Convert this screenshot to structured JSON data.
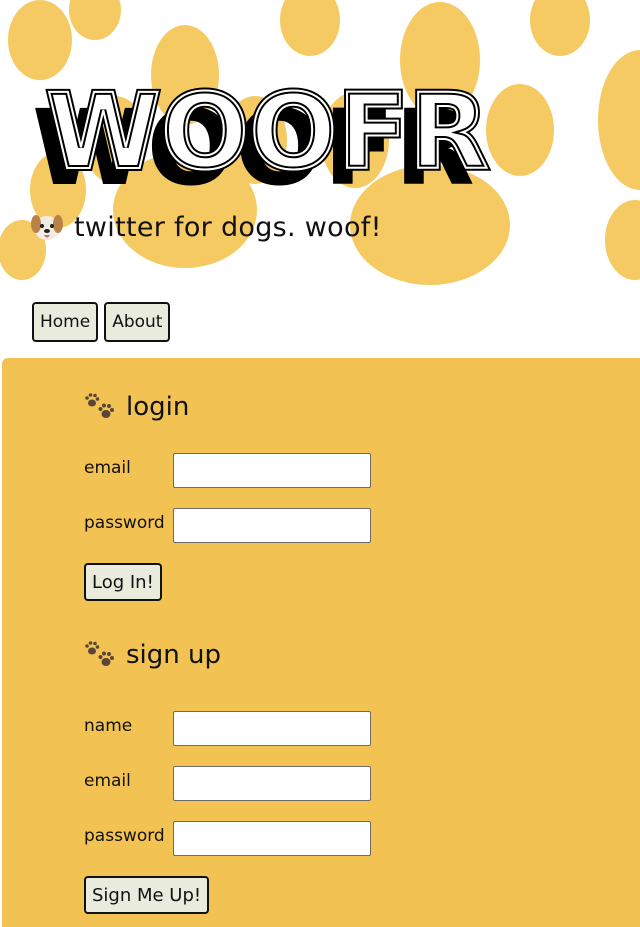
{
  "header": {
    "logo_text": "WOOFR",
    "tagline": "twitter for dogs. woof!",
    "tagline_icon": "dog-face-icon"
  },
  "nav": {
    "items": [
      {
        "label": "Home"
      },
      {
        "label": "About"
      }
    ]
  },
  "login": {
    "title": "login",
    "icon": "paw-prints-icon",
    "email_label": "email",
    "email_value": "",
    "password_label": "password",
    "password_value": "",
    "submit_label": "Log In!"
  },
  "signup": {
    "title": "sign up",
    "icon": "paw-prints-icon",
    "name_label": "name",
    "name_value": "",
    "email_label": "email",
    "email_value": "",
    "password_label": "password",
    "password_value": "",
    "submit_label": "Sign Me Up!"
  },
  "colors": {
    "panel": "#f2c252",
    "paw_background": "#f5c961",
    "button_bg": "#e9ebdc",
    "text": "#111111"
  }
}
